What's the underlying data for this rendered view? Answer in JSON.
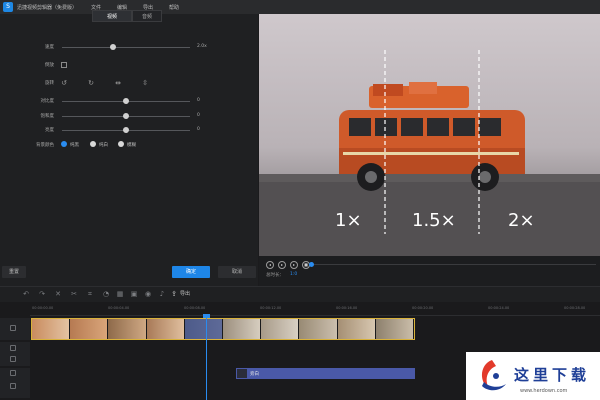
{
  "app": {
    "title": "迅捷视频剪辑器（免费版）",
    "logo_text": "S"
  },
  "menu": [
    "文件",
    "编辑",
    "导出",
    "帮助"
  ],
  "settings": {
    "tabs": [
      {
        "label": "视频",
        "active": true
      },
      {
        "label": "音频",
        "active": false
      }
    ],
    "speed": {
      "label": "速度",
      "value": "2.0x",
      "fraction": 0.4
    },
    "reverse": {
      "label": "倒放",
      "checked": false
    },
    "rotate": {
      "label": "旋转",
      "icons": [
        "rotate-left-icon",
        "rotate-right-icon",
        "flip-horizontal-icon",
        "flip-vertical-icon"
      ]
    },
    "contrast": {
      "label": "对比度",
      "value": "0",
      "fraction": 0.5
    },
    "saturation": {
      "label": "饱和度",
      "value": "0",
      "fraction": 0.5
    },
    "brightness": {
      "label": "亮度",
      "value": "0",
      "fraction": 0.5
    },
    "background": {
      "label": "背景颜色",
      "options": [
        {
          "label": "纯黑",
          "selected": true
        },
        {
          "label": "纯白",
          "selected": false
        },
        {
          "label": "模糊",
          "selected": false
        }
      ]
    },
    "reset_label": "重置",
    "ok_label": "确定",
    "cancel_label": "取消"
  },
  "preview": {
    "overlay": [
      "1×",
      "1.5×",
      "2×"
    ],
    "time_label": "总时长：",
    "time_value": "1:0"
  },
  "toolbar": {
    "export_label": "导出"
  },
  "timeline": {
    "ticks": [
      "00:00:00.00",
      "00:00:04.00",
      "00:00:08.00",
      "00:00:12.00",
      "00:00:16.00",
      "00:00:20.00",
      "00:00:24.00",
      "00:00:28.00"
    ],
    "text_clip_label": "旁白"
  },
  "watermark": {
    "main": "这里下载",
    "sub": "www.herdown.com"
  },
  "colors": {
    "accent": "#1e86e8",
    "clip_border": "#d9b23a",
    "text_clip": "#4a59a8"
  }
}
